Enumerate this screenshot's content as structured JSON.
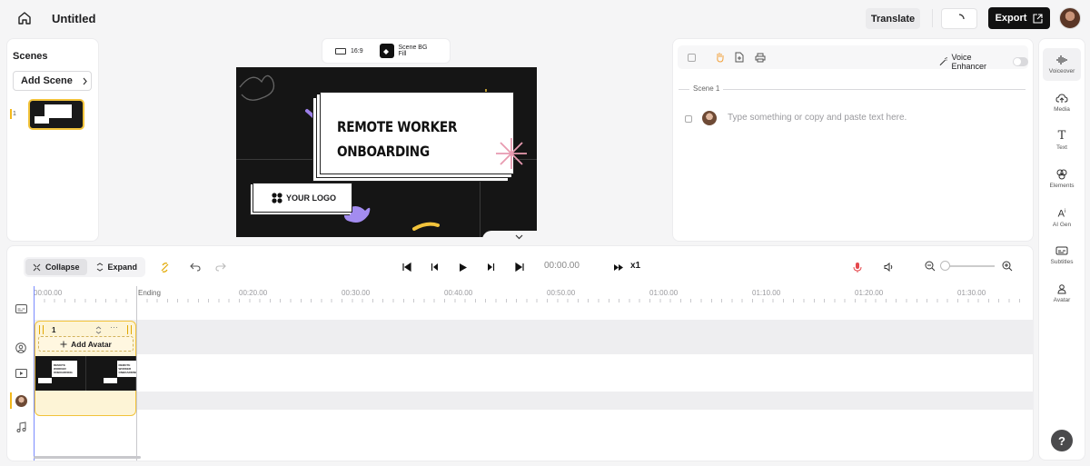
{
  "header": {
    "title": "Untitled",
    "translate_label": "Translate",
    "export_label": "Export"
  },
  "scenes": {
    "title": "Scenes",
    "add_label": "Add Scene",
    "items": [
      {
        "number": "1"
      }
    ]
  },
  "canvas_controls": {
    "ratio_label": "16:9",
    "bg_label": "Scene BG Fill"
  },
  "canvas": {
    "title_line1": "REMOTE WORKER",
    "title_line2": "ONBOARDING",
    "logo_text": "YOUR LOGO"
  },
  "script": {
    "voice_enhancer_label": "Voice Enhancer",
    "voice_enhancer_on": false,
    "scene_label": "Scene 1",
    "placeholder": "Type something or copy and paste text here."
  },
  "rail": {
    "items": [
      {
        "label": "Voiceover",
        "icon": "waveform-icon",
        "active": true
      },
      {
        "label": "Media",
        "icon": "cloud-upload-icon"
      },
      {
        "label": "Text",
        "icon": "text-t-icon"
      },
      {
        "label": "Elements",
        "icon": "shapes-icon"
      },
      {
        "label": "AI Gen",
        "icon": "ai-sparkle-icon"
      },
      {
        "label": "Subtitles",
        "icon": "subtitles-icon"
      },
      {
        "label": "Avatar",
        "icon": "person-icon"
      }
    ],
    "help_label": "?"
  },
  "timeline": {
    "collapse_label": "Collapse",
    "expand_label": "Expand",
    "time": "00:00.00",
    "speed": "x1",
    "ruler": [
      "00:00.00",
      "Ending",
      "00:20.00",
      "00:30.00",
      "00:40.00",
      "00:50.00",
      "01:00.00",
      "01:10.00",
      "01:20.00",
      "01:30.00"
    ],
    "clip_number": "1",
    "add_avatar_label": "Add Avatar",
    "thumb_title": "REMOTE WORKER ONBOARDING"
  },
  "colors": {
    "accent": "#f2c33b",
    "record": "#e5484d",
    "export_bg": "#111111",
    "playhead": "#7a8cff"
  }
}
